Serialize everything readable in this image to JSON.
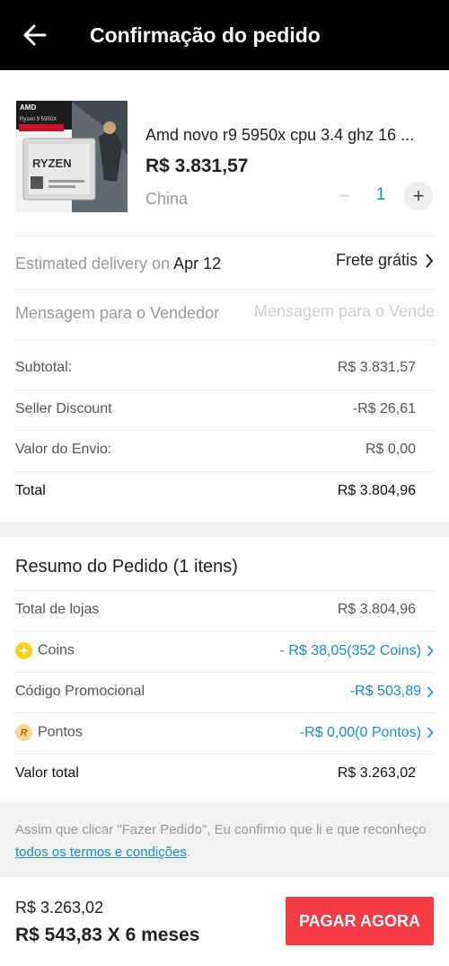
{
  "header": {
    "title": "Confirmação do pedido",
    "back_icon": "arrow-left-icon"
  },
  "product": {
    "title": "Amd novo r9 5950x cpu 3.4 ghz 16 ...",
    "price": "R$ 3.831,57",
    "origin": "China",
    "quantity": "1",
    "minus_label": "−",
    "plus_label": "+",
    "image": {
      "brand": "AMD",
      "model": "Ryzen 9 5950X",
      "chip_text": "RYZEN"
    }
  },
  "delivery": {
    "label": "Estimated delivery on ",
    "date": "Apr 12",
    "shipping": "Frete grátis"
  },
  "message": {
    "label": "Mensagem para o Vendedor",
    "placeholder": "Mensagem para o Vendedor",
    "value": ""
  },
  "summary": {
    "subtotal_label": "Subtotal:",
    "subtotal_value": "R$ 3.831,57",
    "discount_label": "Seller Discount",
    "discount_value": "-R$ 26,61",
    "shipping_label": "Valor do Envio:",
    "shipping_value": "R$ 0,00",
    "total_label": "Total",
    "total_value": "R$ 3.804,96"
  },
  "order_summary": {
    "title": "Resumo do Pedido (1 itens)",
    "stores_label": "Total de lojas",
    "stores_value": "R$ 3.804,96",
    "coins_label": "Coins",
    "coins_value": "- R$ 38,05(352 Coins)",
    "promo_label": "Código Promocional",
    "promo_value": "-R$ 503,89",
    "points_label": "Pontos",
    "points_value": "-R$ 0,00(0 Pontos)",
    "grand_label": "Valor total",
    "grand_value": "R$ 3.263,02"
  },
  "terms": {
    "text": "Assim que clicar \"Fazer Pedido\", Eu confirmo que li e que reconheço ",
    "link": "todos os termos e condições",
    "end": "."
  },
  "footer": {
    "total": "R$ 3.263,02",
    "installments": "R$ 543,83 X 6 meses",
    "pay_label": "PAGAR AGORA"
  },
  "colors": {
    "accent": "#1a8cbf",
    "pay_button": "#f43c46",
    "header_bg": "#000000"
  }
}
